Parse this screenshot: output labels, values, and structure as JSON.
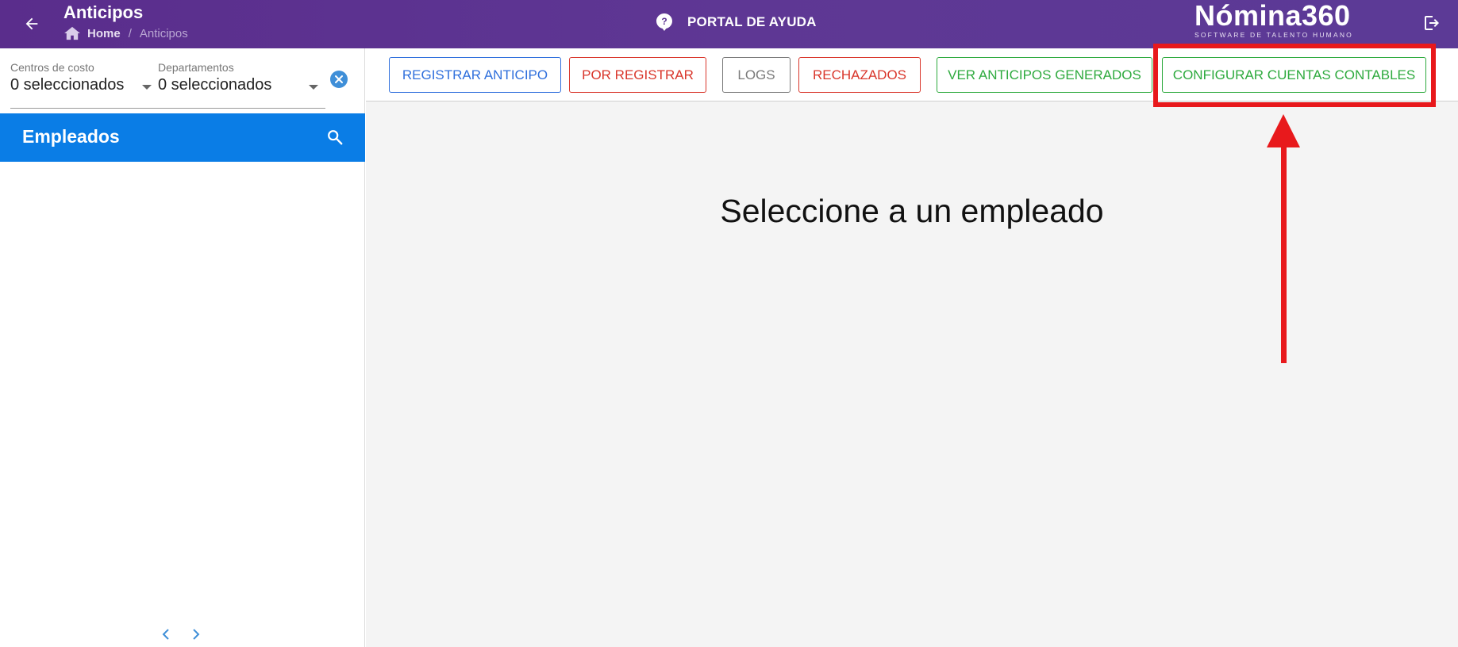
{
  "header": {
    "title": "Anticipos",
    "breadcrumb": {
      "home": "Home",
      "separator": "/",
      "current": "Anticipos"
    },
    "help_label": "PORTAL DE AYUDA",
    "logo_text": "Nómina360",
    "logo_subtitle": "SOFTWARE DE TALENTO HUMANO"
  },
  "filters": {
    "cost_centers": {
      "label": "Centros de costo",
      "value": "0 seleccionados"
    },
    "departments": {
      "label": "Departamentos",
      "value": "0 seleccionados"
    }
  },
  "sidebar": {
    "title": "Empleados"
  },
  "toolbar": {
    "buttons": [
      {
        "label": "REGISTRAR ANTICIPO",
        "color": "#2f6fdc"
      },
      {
        "label": "POR REGISTRAR",
        "color": "#d9362b"
      },
      {
        "label": "LOGS",
        "color": "#7a7a7a"
      },
      {
        "label": "RECHAZADOS",
        "color": "#d9362b"
      },
      {
        "label": "VER ANTICIPOS GENERADOS",
        "color": "#2eaa3e"
      },
      {
        "label": "CONFIGURAR CUENTAS CONTABLES",
        "color": "#2eaa3e"
      }
    ]
  },
  "main": {
    "empty_message": "Seleccione a un empleado"
  },
  "colors": {
    "header": "#5c3391",
    "employees_bar": "#0a7de6",
    "annotation": "#e8191c"
  },
  "icons": {
    "back": "arrow-left-icon",
    "home": "home-icon",
    "help": "help-circle-icon",
    "logout": "logout-icon",
    "clear": "close-circle-icon",
    "search": "search-icon",
    "prev": "chevron-left-icon",
    "next": "chevron-right-icon"
  }
}
